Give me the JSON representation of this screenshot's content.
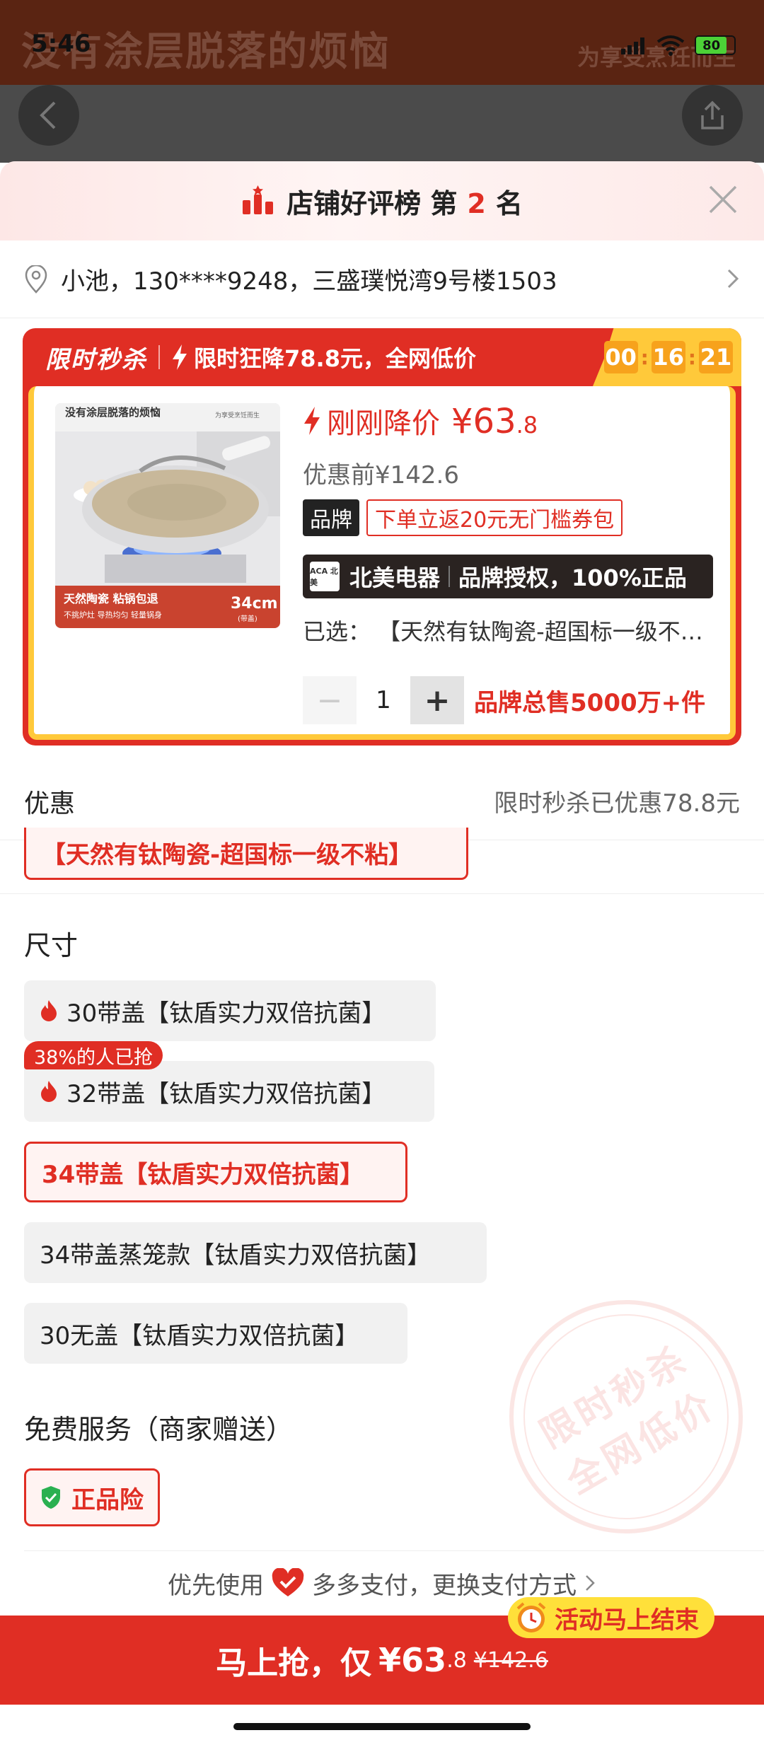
{
  "status_bar": {
    "time": "5:46",
    "battery": "80"
  },
  "background_page": {
    "banner_title": "没有涂层脱落的烦恼",
    "banner_subtitle": "为享受烹饪而生"
  },
  "header": {
    "rank_prefix": "店铺好评榜 第",
    "rank_number": "2",
    "rank_suffix": "名"
  },
  "address": "小池，130****9248，三盛璞悦湾9号楼1503",
  "flash_sale": {
    "logo": "限时秒杀",
    "slogan": "限时狂降78.8元，全网低价",
    "timer": [
      "00",
      "16",
      "21"
    ]
  },
  "product": {
    "image": {
      "headline": "没有涂层脱落的烦恼",
      "tagline": "为享受烹饪而生",
      "feature_line1": "天然陶瓷 粘锅包退",
      "feature_line2": "不挑炉灶 导热均匀 轻量锅身",
      "size": "34cm",
      "size_note": "(带盖)"
    },
    "now_label": "刚刚降价",
    "now_price": "¥63",
    "now_price_decimal": ".8",
    "before_price": "优惠前¥142.6",
    "brand_tag": "品牌",
    "coupon_tag": "下单立返20元无门槛券包",
    "auth_logo": "ACA 北美",
    "auth_store": "北美电器",
    "auth_text": "品牌授权，100%正品",
    "selected": "已选：  【天然有钛陶瓷-超国标一级不粘】",
    "quantity": "1",
    "sales": "品牌总售5000万+件"
  },
  "discount": {
    "label": "优惠",
    "value": "限时秒杀已优惠78.8元"
  },
  "cut_option": "【天然有钛陶瓷-超国标一级不粘】",
  "size_section": {
    "label": "尺寸",
    "hot_badge": "38%的人已抢",
    "options": [
      "30带盖【钛盾实力双倍抗菌】",
      "32带盖【钛盾实力双倍抗菌】",
      "34带盖【钛盾实力双倍抗菌】",
      "34带盖蒸笼款【钛盾实力双倍抗菌】",
      "30无盖【钛盾实力双倍抗菌】"
    ]
  },
  "service_section": {
    "label": "免费服务（商家赠送）",
    "item": "正品险"
  },
  "stamp": {
    "line1": "限时秒杀",
    "line2": "全网低价"
  },
  "payment": {
    "prefix": "优先使用",
    "method": "多多支付，更换支付方式"
  },
  "cta": {
    "label": "马上抢，仅",
    "price": "¥63",
    "price_decimal": ".8",
    "old_price": "¥142.6",
    "ending_badge": "活动马上结束"
  },
  "colors": {
    "accent": "#e02e24",
    "timer_bg": "#ffc93a",
    "badge_yellow": "#ffe03a"
  }
}
